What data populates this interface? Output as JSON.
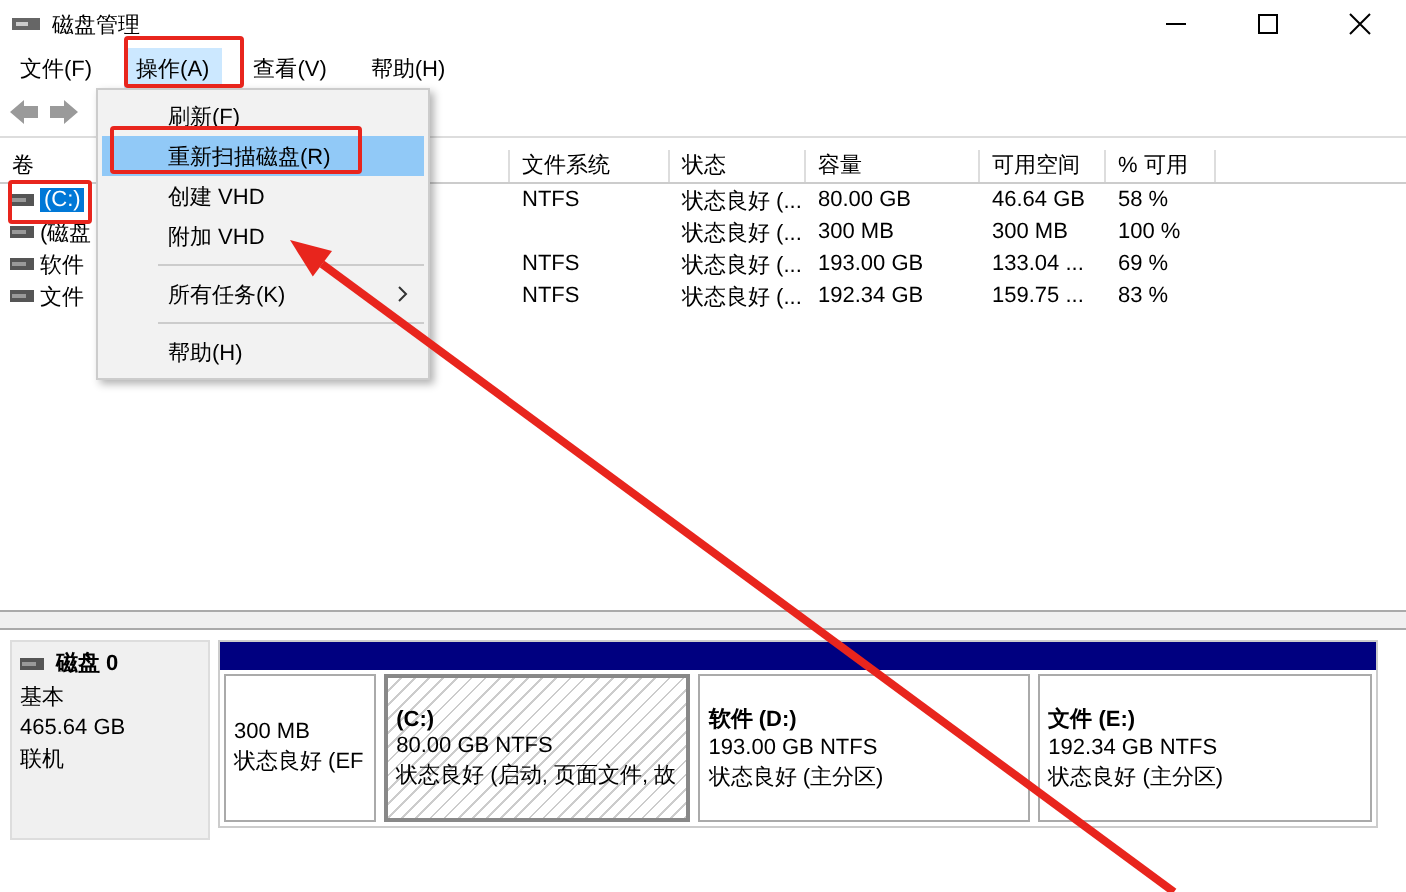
{
  "window": {
    "title": "磁盘管理"
  },
  "menu_bar": [
    {
      "label": "文件(F)",
      "selected": false
    },
    {
      "label": "操作(A)",
      "selected": true
    },
    {
      "label": "查看(V)",
      "selected": false
    },
    {
      "label": "帮助(H)",
      "selected": false
    }
  ],
  "context_menu": [
    {
      "kind": "item",
      "label": "刷新(F)",
      "selected": false
    },
    {
      "kind": "item",
      "label": "重新扫描磁盘(R)",
      "selected": true
    },
    {
      "kind": "item",
      "label": "创建 VHD",
      "selected": false
    },
    {
      "kind": "item",
      "label": "附加 VHD",
      "selected": false
    },
    {
      "kind": "separator"
    },
    {
      "kind": "submenu",
      "label": "所有任务(K)",
      "selected": false
    },
    {
      "kind": "separator"
    },
    {
      "kind": "item",
      "label": "帮助(H)",
      "selected": false
    }
  ],
  "volume_table": {
    "columns": [
      "卷",
      "文件系统",
      "状态",
      "容量",
      "可用空间",
      "% 可用"
    ],
    "rows": [
      {
        "volume": "(C:)",
        "file_system": "NTFS",
        "status": "状态良好 (...",
        "capacity": "80.00 GB",
        "free": "46.64 GB",
        "percent_free": "58 %",
        "selected": true
      },
      {
        "volume": "(磁盘",
        "status": "状态良好 (...",
        "capacity": "300 MB",
        "free": "300 MB",
        "percent_free": "100 %",
        "selected": false
      },
      {
        "volume": "软件",
        "file_system": "NTFS",
        "status": "状态良好 (...",
        "capacity": "193.00 GB",
        "free": "133.04 ...",
        "percent_free": "69 %",
        "selected": false
      },
      {
        "volume": "文件",
        "file_system": "NTFS",
        "status": "状态良好 (...",
        "capacity": "192.34 GB",
        "free": "159.75 ...",
        "percent_free": "83 %",
        "selected": false
      }
    ]
  },
  "disk": {
    "name": "磁盘 0",
    "type": "基本",
    "size": "465.64 GB",
    "state": "联机",
    "partitions": [
      {
        "size": "300 MB",
        "status": "状态良好 (EF",
        "selected": false
      },
      {
        "label": "(C:)",
        "size": "80.00 GB NTFS",
        "status": "状态良好 (启动, 页面文件, 故",
        "selected": true
      },
      {
        "label": "软件  (D:)",
        "size": "193.00 GB NTFS",
        "status": "状态良好 (主分区)",
        "selected": false
      },
      {
        "label": "文件  (E:)",
        "size": "192.34 GB NTFS",
        "status": "状态良好 (主分区)",
        "selected": false
      }
    ]
  }
}
